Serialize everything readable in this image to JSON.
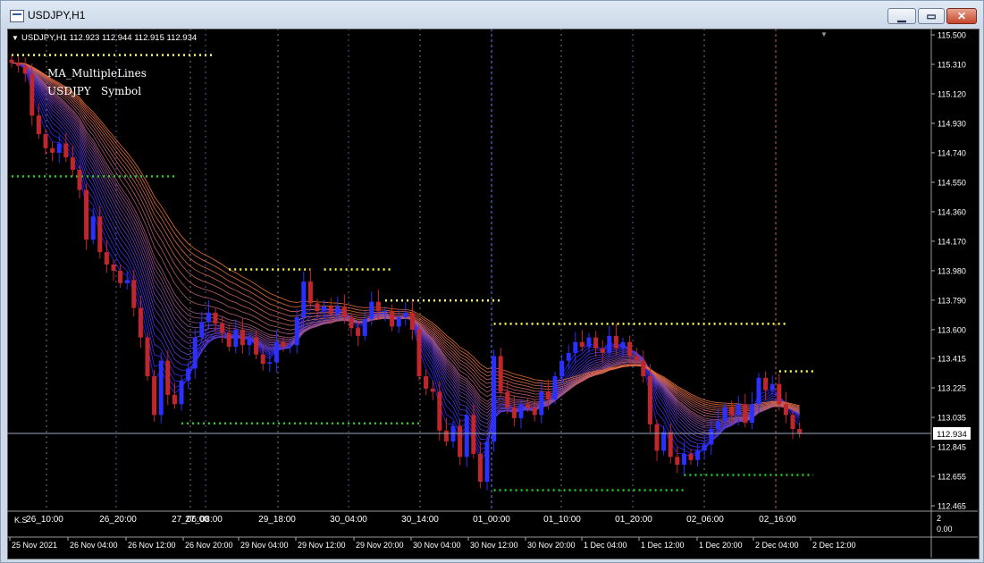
{
  "window": {
    "title": "USDJPY,H1"
  },
  "icons": {
    "app": "chart-window-icon",
    "min": "minimize-icon",
    "max": "maximize-icon",
    "close": "close-icon"
  },
  "header": {
    "symbol_info": "USDJPY,H1  112.923 112.944 112.915 112.934"
  },
  "indicator": {
    "name": "MA_MultipleLines",
    "symbol": "USDJPY",
    "symbol_label": "Symbol"
  },
  "price": {
    "last_label": "112.934"
  },
  "subwindow": {
    "label": "K.S",
    "scale_top": "2",
    "scale_bottom": "0.00"
  },
  "colors": {
    "bull": "#2b30ff",
    "bear": "#c0262b",
    "resistance": "#ffff55",
    "support": "#22cc22",
    "background": "#000000",
    "grid": "#4a4a4a"
  },
  "chart_data": {
    "type": "candlestick",
    "symbol": "USDJPY",
    "timeframe": "H1",
    "ohlc_header": {
      "open": 112.923,
      "high": 112.944,
      "low": 112.915,
      "close": 112.934
    },
    "y_ticks": [
      "115.500",
      "115.310",
      "115.120",
      "114.930",
      "114.740",
      "114.550",
      "114.360",
      "114.170",
      "113.980",
      "113.790",
      "113.600",
      "113.415",
      "113.225",
      "113.035",
      "112.845",
      "112.655",
      "112.465"
    ],
    "ylim": [
      112.465,
      115.5
    ],
    "time_markers": [
      "26_10:00",
      "26_20:00",
      "27_06:00",
      "27_08:00",
      "29_18:00",
      "30_04:00",
      "30_14:00",
      "01_00:00",
      "01_10:00",
      "01_20:00",
      "02_06:00",
      "02_16:00"
    ],
    "x_ticks": [
      "25 Nov 2021",
      "26 Nov 04:00",
      "26 Nov 12:00",
      "26 Nov 20:00",
      "29 Nov 04:00",
      "29 Nov 12:00",
      "29 Nov 20:00",
      "30 Nov 04:00",
      "30 Nov 12:00",
      "30 Nov 20:00",
      "1 Dec 04:00",
      "1 Dec 12:00",
      "1 Dec 20:00",
      "2 Dec 04:00",
      "2 Dec 12:00"
    ],
    "closes": [
      115.32,
      115.3,
      115.25,
      114.98,
      114.86,
      114.77,
      114.74,
      114.8,
      114.71,
      114.63,
      114.5,
      114.18,
      114.33,
      114.1,
      114.02,
      113.98,
      113.9,
      113.92,
      113.74,
      113.55,
      113.3,
      113.05,
      113.4,
      113.18,
      113.12,
      113.27,
      113.35,
      113.55,
      113.65,
      113.71,
      113.64,
      113.58,
      113.49,
      113.6,
      113.5,
      113.55,
      113.44,
      113.38,
      113.39,
      113.52,
      113.49,
      113.5,
      113.68,
      113.91,
      113.77,
      113.72,
      113.75,
      113.7,
      113.75,
      113.68,
      113.61,
      113.56,
      113.67,
      113.78,
      113.72,
      113.72,
      113.62,
      113.68,
      113.71,
      113.6,
      113.3,
      113.22,
      113.2,
      112.95,
      112.88,
      112.98,
      112.78,
      113.05,
      112.8,
      112.62,
      112.88,
      113.43,
      113.2,
      113.1,
      113.03,
      113.12,
      113.1,
      113.05,
      113.2,
      113.15,
      113.3,
      113.4,
      113.45,
      113.52,
      113.49,
      113.55,
      113.48,
      113.45,
      113.56,
      113.48,
      113.52,
      113.43,
      113.4,
      113.3,
      112.99,
      112.82,
      112.94,
      112.78,
      112.73,
      112.8,
      112.76,
      112.82,
      112.86,
      112.96,
      113.01,
      113.1,
      113.05,
      113.12,
      113.0,
      113.12,
      113.29,
      113.21,
      113.25,
      113.12,
      113.05,
      112.96,
      112.934
    ]
  }
}
